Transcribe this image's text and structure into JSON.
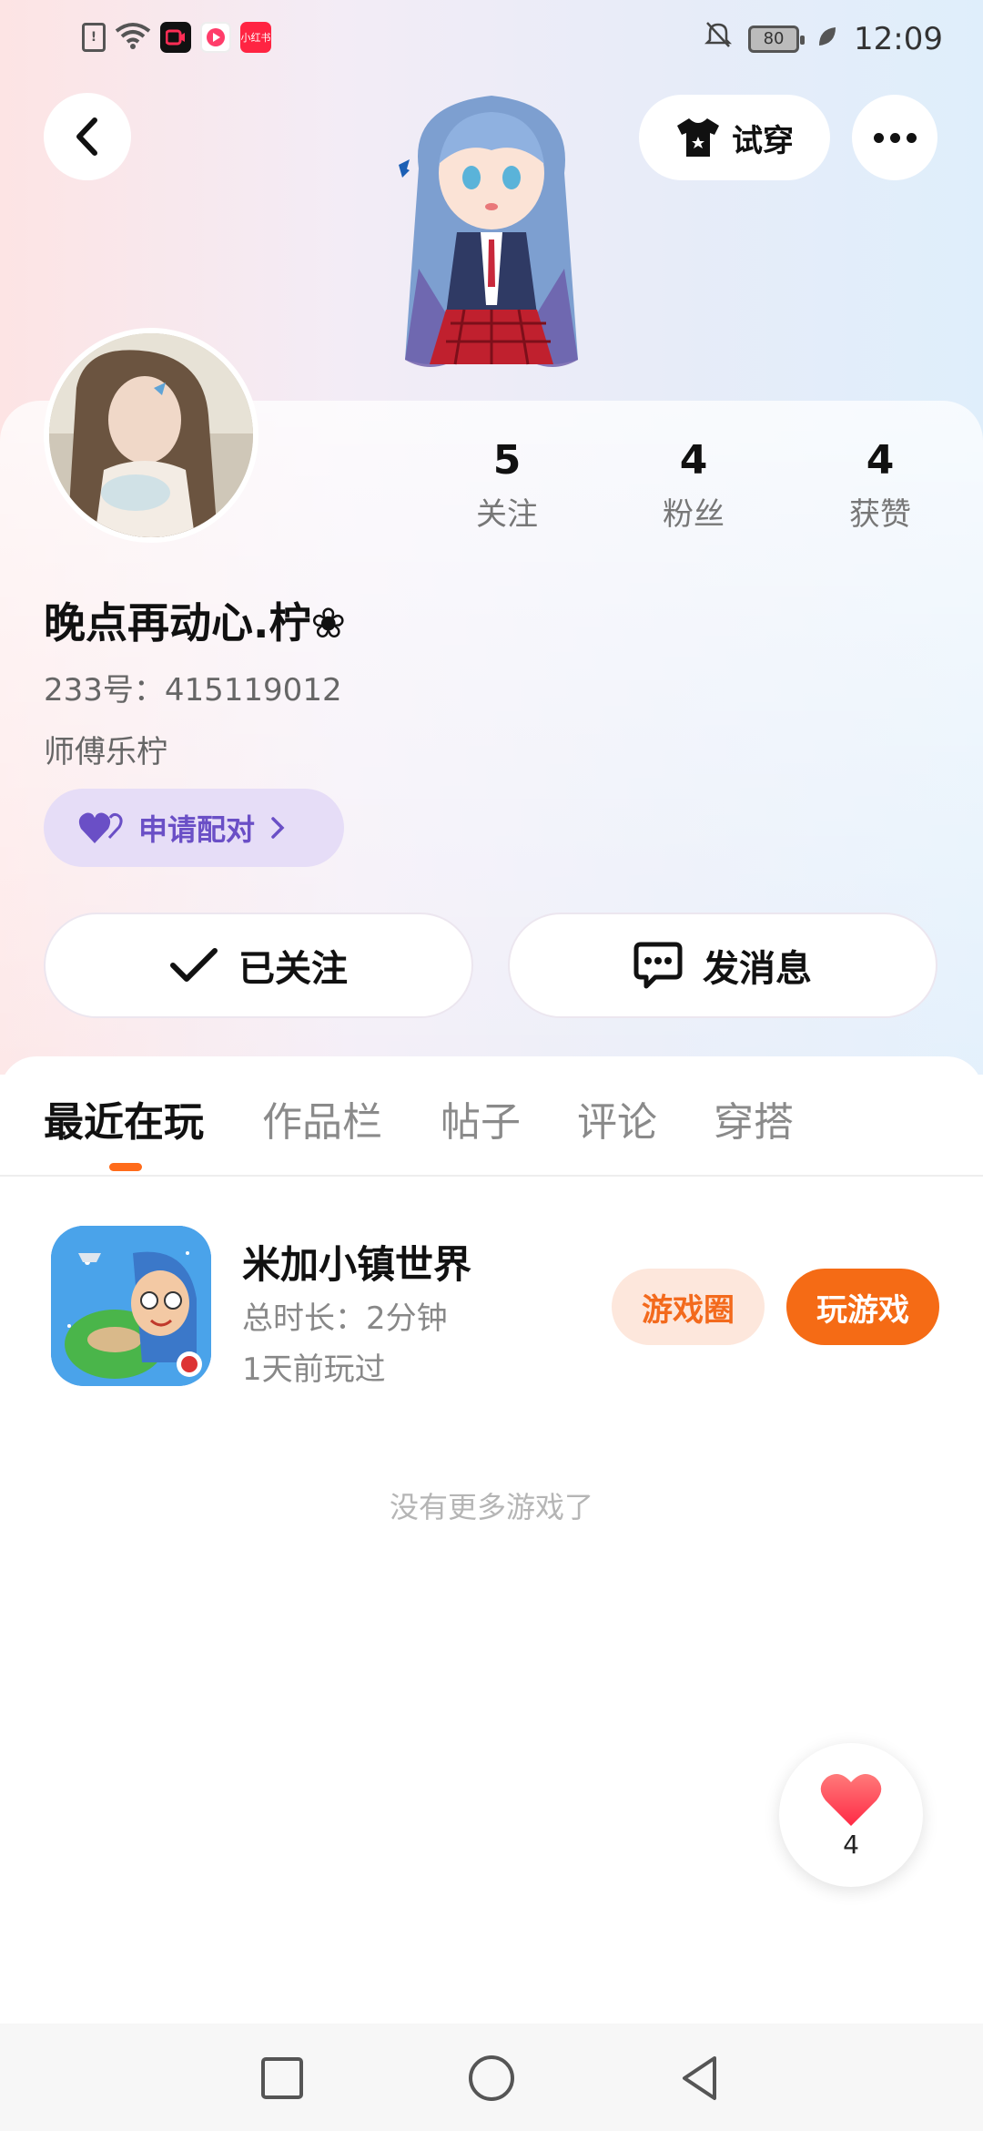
{
  "status_bar": {
    "time": "12:09",
    "battery": "80",
    "app_icons": [
      {
        "name": "sim-alert-icon",
        "color": "#555555",
        "label": "!"
      },
      {
        "name": "wifi-icon",
        "color": "#555555",
        "label": ""
      },
      {
        "name": "record-app-icon",
        "color": "#111111",
        "label": ""
      },
      {
        "name": "video-app-icon",
        "color": "#ff3d6a",
        "label": ""
      },
      {
        "name": "xiaohongshu-app-icon",
        "color": "#ff2442",
        "label": "小红书"
      }
    ]
  },
  "header": {
    "try_on_label": "试穿"
  },
  "profile": {
    "stats": [
      {
        "value": "5",
        "label": "关注"
      },
      {
        "value": "4",
        "label": "粉丝"
      },
      {
        "value": "4",
        "label": "获赞"
      }
    ],
    "nickname": "晚点再动心.柠❀",
    "uid": "233号：415119012",
    "bio": "师傅乐柠",
    "pair_label": "申请配对",
    "follow_label": "已关注",
    "message_label": "发消息"
  },
  "tabs": [
    {
      "label": "最近在玩",
      "active": true
    },
    {
      "label": "作品栏",
      "active": false
    },
    {
      "label": "帖子",
      "active": false
    },
    {
      "label": "评论",
      "active": false
    },
    {
      "label": "穿搭",
      "active": false
    }
  ],
  "games": [
    {
      "title": "米加小镇世界",
      "duration": "总时长：2分钟",
      "last_played": "1天前玩过",
      "circle_label": "游戏圈",
      "play_label": "玩游戏"
    }
  ],
  "list_footer": "没有更多游戏了",
  "like_fab": {
    "count": "4"
  },
  "colors": {
    "accent_orange": "#f56b15",
    "pair_purple": "#6a4fc6",
    "like_red": "#ff3b4e"
  }
}
